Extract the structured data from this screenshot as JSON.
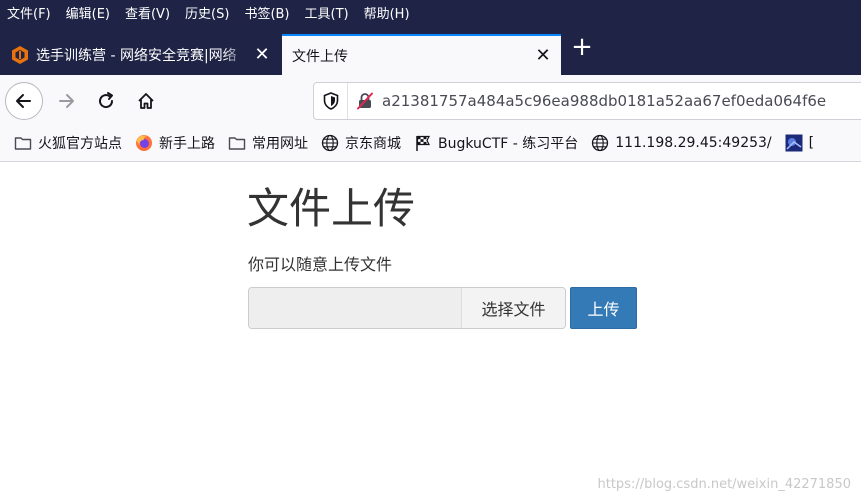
{
  "menu": [
    "文件(F)",
    "编辑(E)",
    "查看(V)",
    "历史(S)",
    "书签(B)",
    "工具(T)",
    "帮助(H)"
  ],
  "tabs": [
    {
      "title": "选手训练营 - 网络安全竞赛|网络",
      "icon": "training-camp-icon",
      "active": false
    },
    {
      "title": "文件上传",
      "active": true
    }
  ],
  "url": "a21381757a484a5c96ea988db0181a52aa67ef0eda064f6e",
  "bookmarks": [
    {
      "label": "火狐官方站点",
      "icon": "folder-icon"
    },
    {
      "label": "新手上路",
      "icon": "firefox-icon"
    },
    {
      "label": "常用网址",
      "icon": "folder-icon"
    },
    {
      "label": "京东商城",
      "icon": "globe-icon"
    },
    {
      "label": "BugkuCTF - 练习平台",
      "icon": "checkered-flag-icon"
    },
    {
      "label": "111.198.29.45:49253/",
      "icon": "globe-icon"
    },
    {
      "label": "[",
      "icon": "site-thumbnail-icon"
    }
  ],
  "page": {
    "heading": "文件上传",
    "description": "你可以随意上传文件",
    "choose_label": "选择文件",
    "upload_label": "上传"
  },
  "watermark": "https://blog.csdn.net/weixin_42271850",
  "colors": {
    "chrome_dark": "#1f2346",
    "upload_button": "#337ab7",
    "active_tab_accent": "#0a84ff"
  }
}
